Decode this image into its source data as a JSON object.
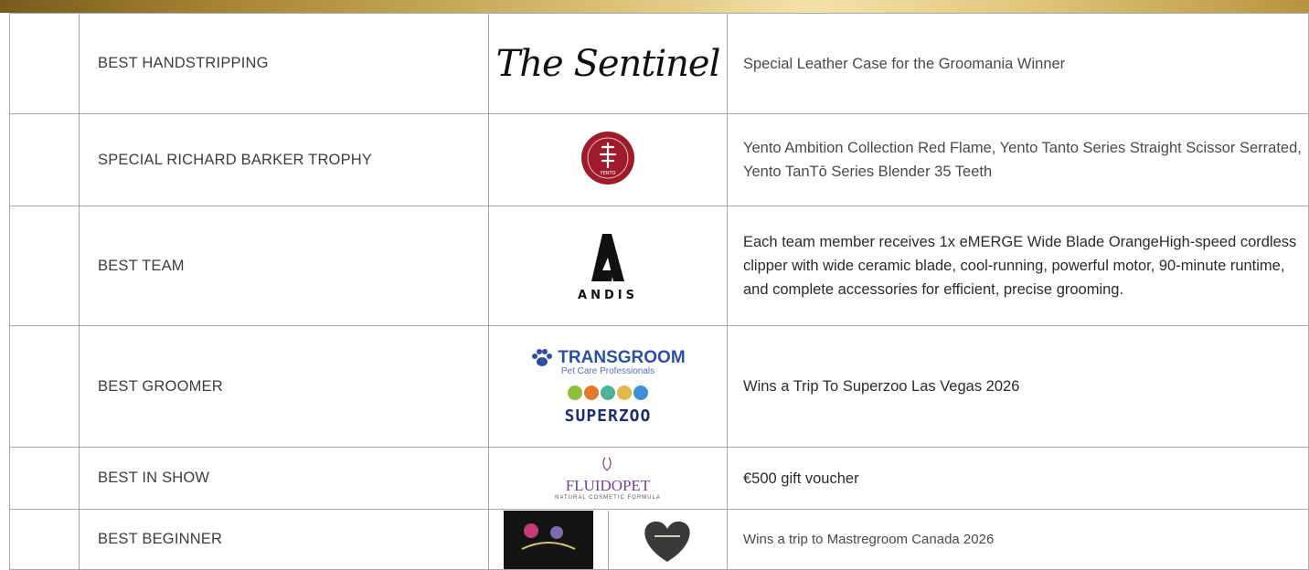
{
  "awards": [
    {
      "category": "BEST HANDSTRIPPING",
      "prize": "Special Leather Case for the Groomania Winner",
      "logo_text": "The Sentinel"
    },
    {
      "category": "SPECIAL RICHARD BARKER TROPHY",
      "prize": "Yento Ambition Collection Red Flame, Yento Tanto Series Straight Scissor Serrated, Yento TanTō Series Blender 35 Teeth",
      "logo_text": "YENTO"
    },
    {
      "category": "BEST TEAM",
      "prize": "Each team member receives 1x eMERGE Wide Blade OrangeHigh-speed cordless clipper with wide ceramic blade, cool-running, powerful motor, 90-minute runtime, and complete accessories for efficient, precise grooming.",
      "logo_text": "ANDIS"
    },
    {
      "category": "BEST GROOMER",
      "prize": "Wins a Trip To Superzoo Las Vegas 2026",
      "logo_text": "TRANSGROOM",
      "logo_subtext": "Pet Care Professionals",
      "logo_text_2": "SUPERZOO"
    },
    {
      "category": "BEST IN SHOW",
      "prize": "€500 gift voucher",
      "logo_text": "FLUIDOPET",
      "logo_subtext": "NATURAL COSMETIC FORMULA"
    },
    {
      "category": "BEST BEGINNER",
      "prize": "Wins a trip to Mastregroom Canada 2026"
    }
  ],
  "colors": {
    "gold_bar": "#c9a24f",
    "border": "#a8a8a8",
    "yento_red": "#9e1b2c",
    "transgroom_blue": "#2d4fa3",
    "fluidopet_purple": "#7a3f95"
  }
}
